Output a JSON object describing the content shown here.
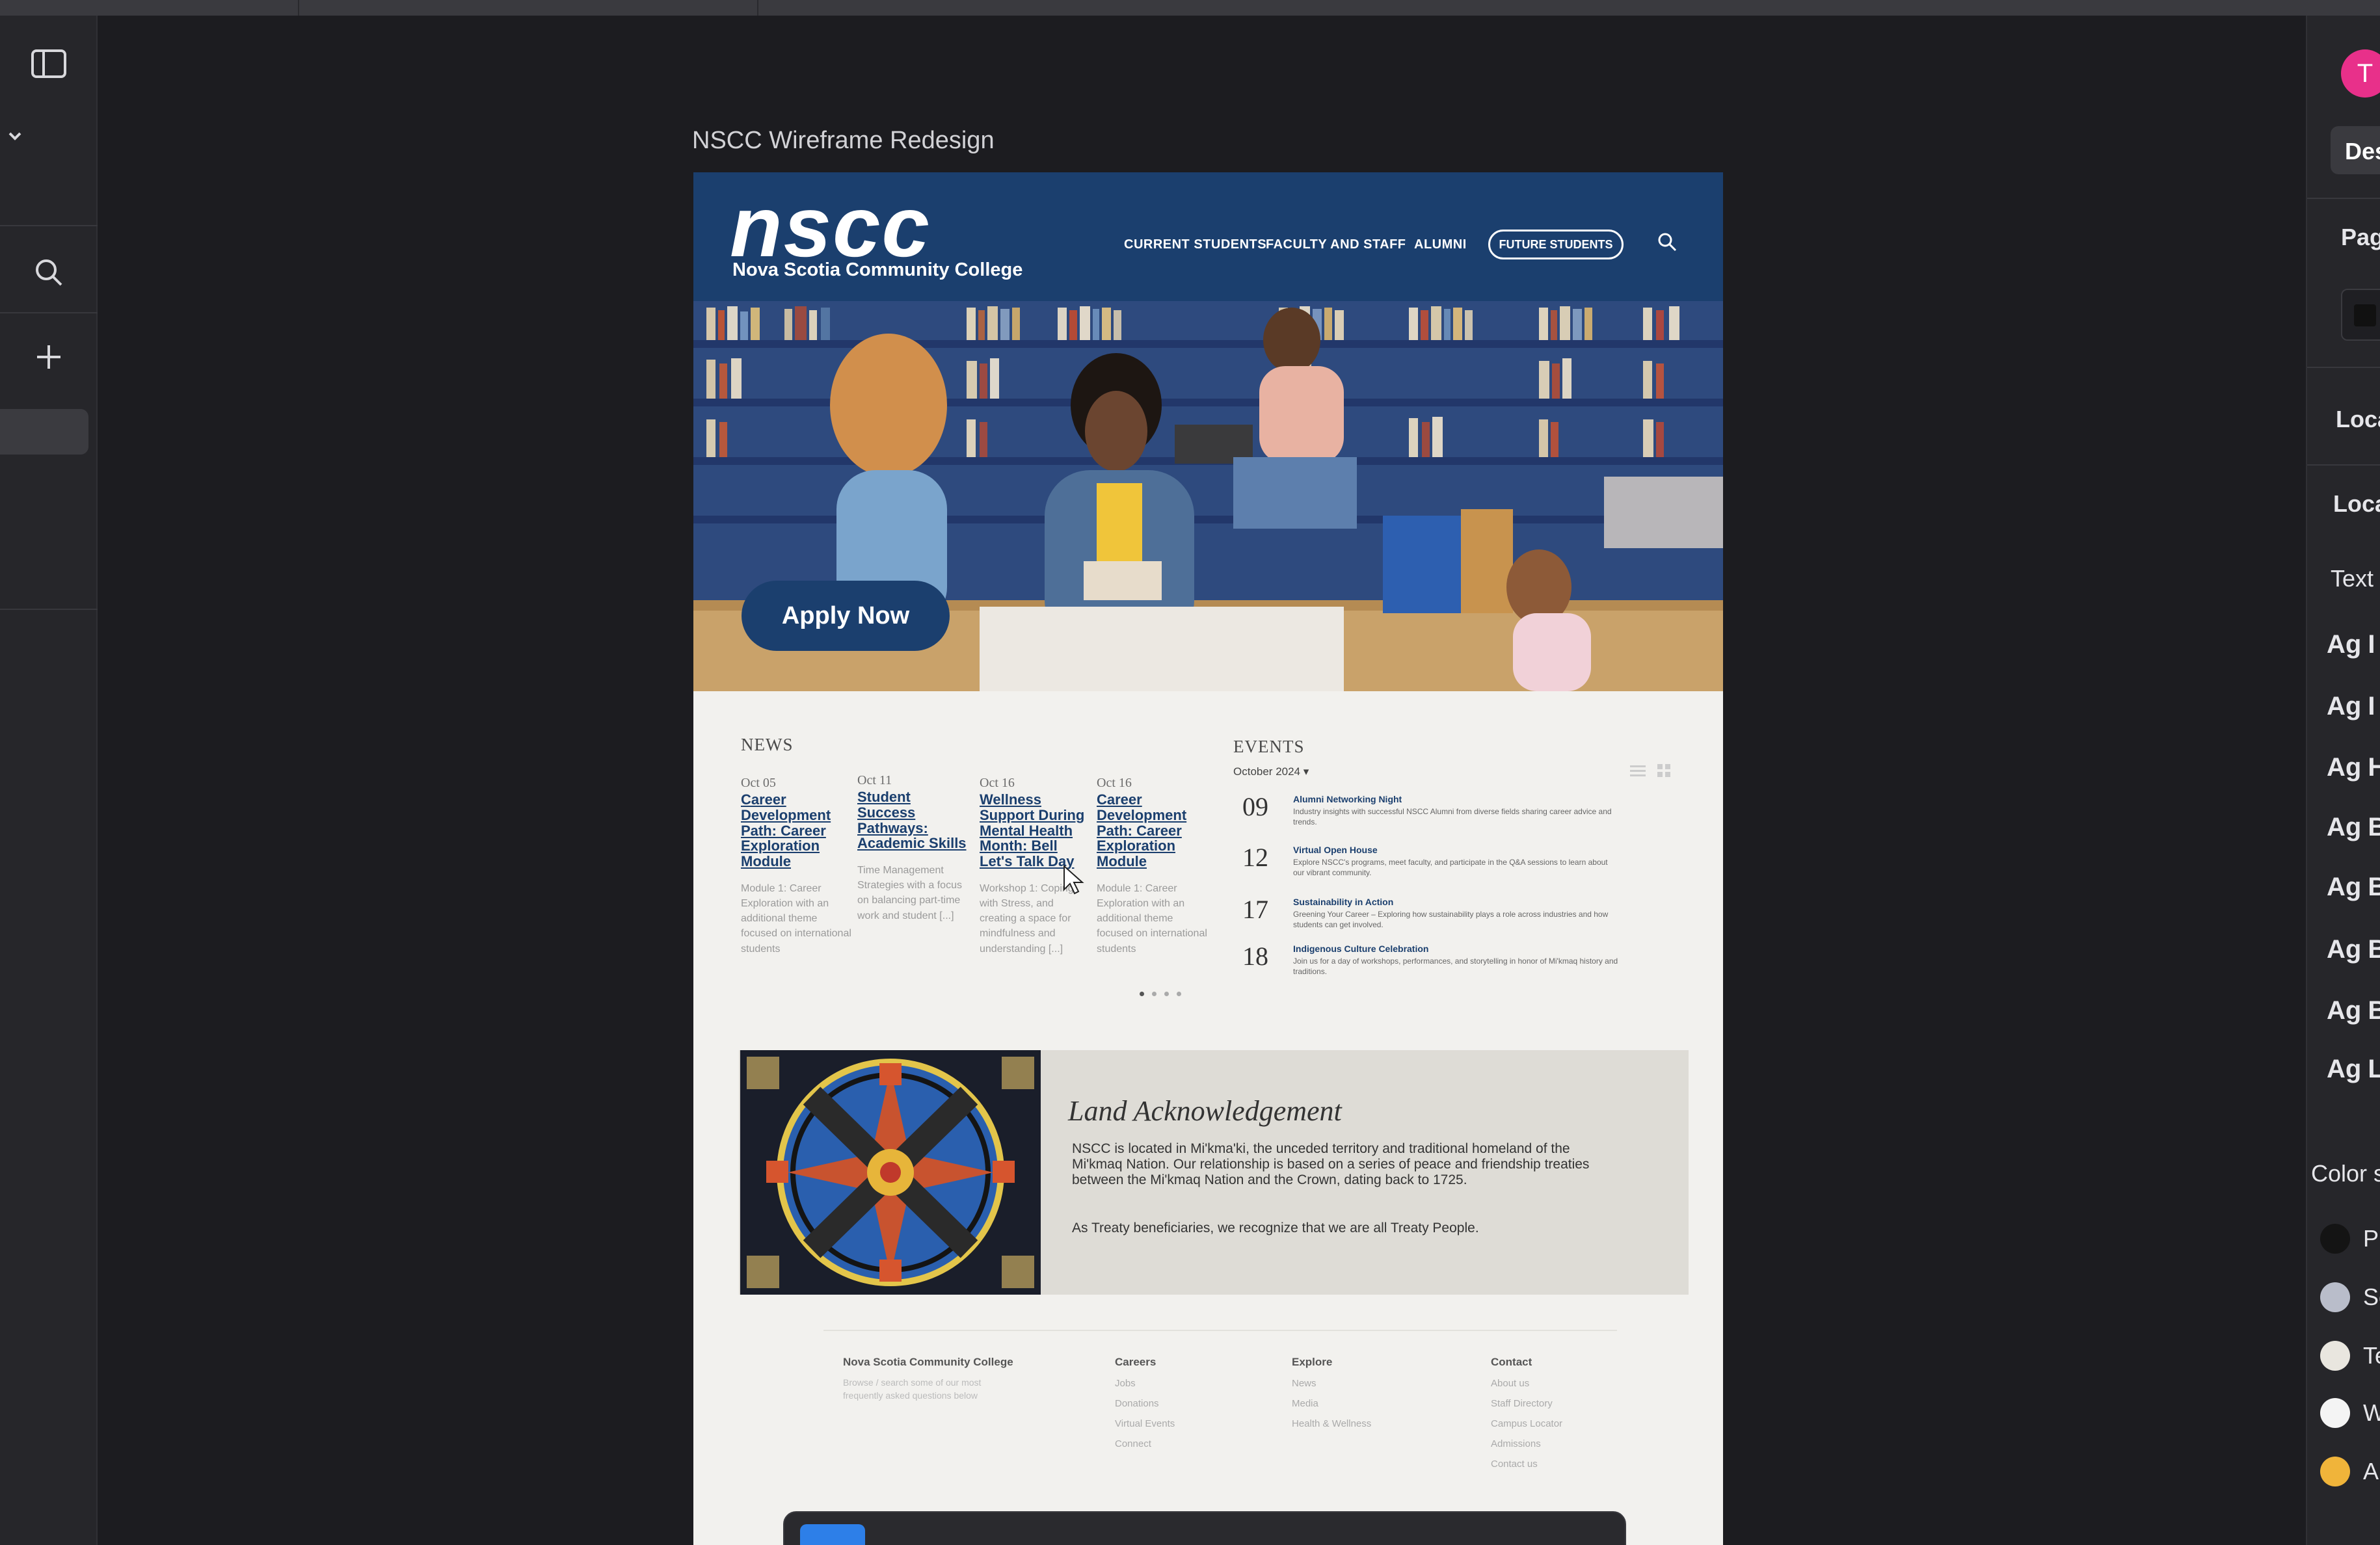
{
  "editor": {
    "frame_title": "NSCC Wireframe Redesign",
    "left_rail": {
      "icons": [
        "sidebar-toggle-icon",
        "chevron-down-icon",
        "search-icon",
        "plus-icon"
      ]
    },
    "inspector": {
      "avatar_initial": "T",
      "tab_label": "Des",
      "labels": [
        "Pag",
        "Loca",
        "Loca",
        "Text"
      ],
      "text_styles": [
        {
          "sample": "Ag",
          "name": "I"
        },
        {
          "sample": "Ag",
          "name": "I"
        },
        {
          "sample": "Ag",
          "name": "H"
        },
        {
          "sample": "Ag",
          "name": "B"
        },
        {
          "sample": "Ag",
          "name": "B"
        },
        {
          "sample": "Ag",
          "name": "B"
        },
        {
          "sample": "Ag",
          "name": "Bo"
        },
        {
          "sample": "Ag",
          "name": "Li"
        }
      ],
      "color_styles_label": "Color s",
      "colors": [
        {
          "name": "Pri",
          "hex": "#141414"
        },
        {
          "name": "Sec",
          "hex": "#b9bdca"
        },
        {
          "name": "Ter",
          "hex": "#e9e6df"
        },
        {
          "name": "Whi",
          "hex": "#f4f4f4"
        },
        {
          "name": "Ann",
          "hex": "#f0b43a"
        }
      ]
    }
  },
  "site": {
    "logo": "nscc",
    "logo_sub": "Nova Scotia Community College",
    "nav": [
      "CURRENT STUDENTS",
      "FACULTY AND STAFF",
      "ALUMNI"
    ],
    "nav_cta": "FUTURE STUDENTS",
    "hero_cta": "Apply Now",
    "news": {
      "heading": "NEWS",
      "items": [
        {
          "date": "Oct 05",
          "title": "Career Development Path: Career Exploration Module",
          "body": "Module 1: Career Exploration with an additional theme focused on international students"
        },
        {
          "date": "Oct 11",
          "title": "Student Success Pathways: Academic Skills",
          "body": "Time Management Strategies with a focus on balancing part-time work and student [...]"
        },
        {
          "date": "Oct 16",
          "title": "Wellness Support During Mental Health Month: Bell Let's Talk Day",
          "body": "Workshop 1: Coping with Stress, and creating a space for mindfulness and understanding [...]"
        },
        {
          "date": "Oct 16",
          "title": "Career Development Path: Career Exploration Module",
          "body": "Module 1: Career Exploration with an additional theme focused on international students"
        }
      ]
    },
    "events": {
      "heading": "EVENTS",
      "month": "October 2024",
      "items": [
        {
          "day": "09",
          "title": "Alumni Networking Night",
          "desc": "Industry insights with successful NSCC Alumni from diverse fields sharing career advice and trends."
        },
        {
          "day": "12",
          "title": "Virtual Open House",
          "desc": "Explore NSCC's programs, meet faculty, and participate in the Q&A sessions to learn about our vibrant community."
        },
        {
          "day": "17",
          "title": "Sustainability in Action",
          "desc": "Greening Your Career – Exploring how sustainability plays a role across industries and how students can get involved."
        },
        {
          "day": "18",
          "title": "Indigenous Culture Celebration",
          "desc": "Join us for a day of workshops, performances, and storytelling in honor of Mi'kmaq history and traditions."
        }
      ]
    },
    "land": {
      "title": "Land Acknowledgement",
      "p1": "NSCC is located in Mi'kma'ki, the unceded territory and traditional homeland of the Mi'kmaq Nation. Our relationship is based on a series of peace and friendship treaties between the Mi'kmaq Nation and the Crown, dating back to 1725.",
      "p2": "As Treaty beneficiaries, we recognize that we are all Treaty People."
    },
    "footer": {
      "about_heading": "Nova Scotia Community College",
      "about_text": "Browse / search some of our most frequently asked questions below",
      "columns": [
        {
          "heading": "Careers",
          "links": [
            "Jobs",
            "Donations",
            "Virtual Events",
            "Connect"
          ]
        },
        {
          "heading": "Explore",
          "links": [
            "News",
            "Media",
            "Health & Wellness"
          ]
        },
        {
          "heading": "Contact",
          "links": [
            "About us",
            "Staff Directory",
            "Campus Locator",
            "Admissions",
            "Contact us"
          ]
        }
      ]
    }
  }
}
